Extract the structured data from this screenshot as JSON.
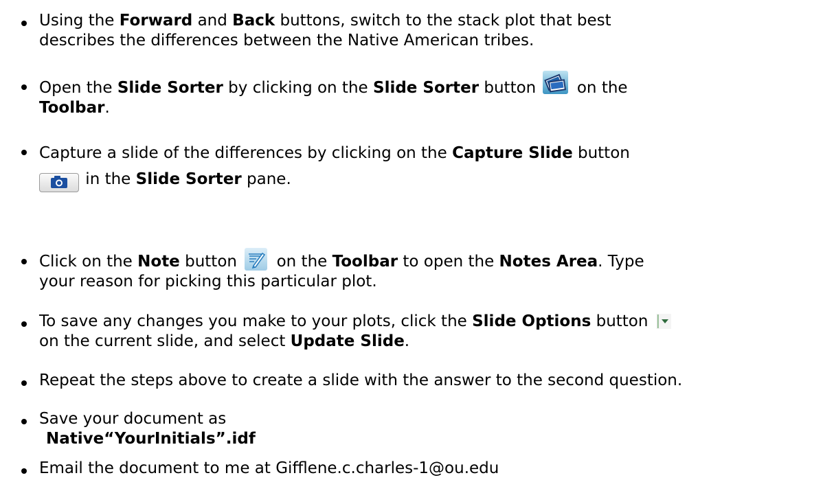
{
  "items": [
    {
      "parts": [
        "Using the ",
        "Forward",
        " and ",
        "Back",
        " buttons, switch to the stack plot that best",
        "describes the differences between the Native American tribes."
      ]
    },
    {
      "parts": [
        "Open the ",
        "Slide Sorter",
        " by clicking on the ",
        "Slide Sorter",
        " button ",
        " on the",
        "Toolbar",
        "."
      ],
      "icon": "slide-sorter-icon"
    },
    {
      "parts": [
        "Capture a slide of the differences by clicking on the ",
        "Capture Slide",
        " button",
        " in the ",
        "Slide Sorter",
        " pane."
      ],
      "icon": "camera-icon"
    },
    {
      "parts": [
        "Click on the ",
        "Note",
        " button ",
        " on the ",
        "Toolbar",
        " to open the ",
        "Notes Area",
        ". Type",
        "your reason for picking this particular plot."
      ],
      "icon": "note-pencil-icon"
    },
    {
      "parts": [
        "To save any changes you make to your plots, click the ",
        "Slide Options",
        " button ",
        "on the current slide, and select ",
        "Update Slide",
        "."
      ],
      "icon": "slide-options-dropdown-icon"
    },
    {
      "parts": [
        "Repeat the steps above to create a slide with the answer to the second question."
      ]
    },
    {
      "parts": [
        "Save your document as",
        "Native“YourInitials”.idf"
      ]
    },
    {
      "parts": [
        "Email the document to me at Gifflene.c.charles-1@ou.edu"
      ]
    }
  ]
}
